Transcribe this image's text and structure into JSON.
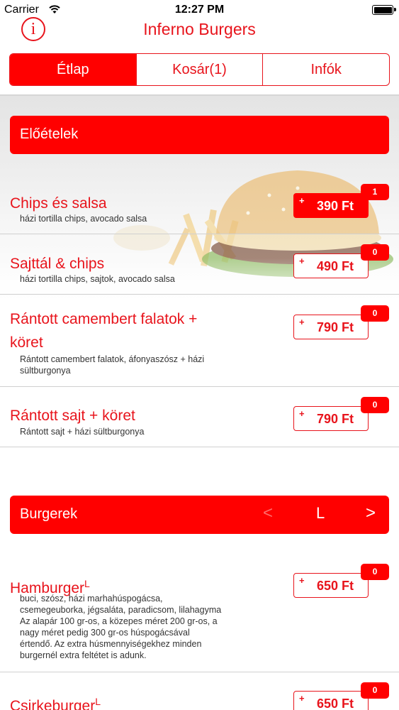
{
  "status_bar": {
    "carrier": "Carrier",
    "time": "12:27 PM"
  },
  "header": {
    "info_glyph": "i",
    "title": "Inferno Burgers"
  },
  "tabs": [
    {
      "label": "Étlap",
      "active": true
    },
    {
      "label": "Kosár(1)",
      "active": false
    },
    {
      "label": "Infók",
      "active": false
    }
  ],
  "sections": [
    {
      "title": "Előételek",
      "items": [
        {
          "name": "Chips és salsa",
          "desc": "házi tortilla chips, avocado salsa",
          "plus": "+",
          "price": "390 Ft",
          "count": "1"
        },
        {
          "name": "Sajttál & chips",
          "desc": "házi tortilla chips, sajtok, avocado salsa",
          "plus": "+",
          "price": "490 Ft",
          "count": "0"
        },
        {
          "name_line1": "Rántott camembert falatok +",
          "name_line2": "köret",
          "desc_line1": "Rántott camembert falatok, áfonyaszósz + házi",
          "desc_line2": "sültburgonya",
          "plus": "+",
          "price": "790 Ft",
          "count": "0"
        },
        {
          "name": "Rántott sajt + köret",
          "desc": "Rántott sajt + házi sültburgonya",
          "plus": "+",
          "price": "790 Ft",
          "count": "0"
        }
      ]
    },
    {
      "title": "Burgerek",
      "nav": {
        "prev": "<",
        "size": "L",
        "next": ">"
      },
      "items": [
        {
          "name": "Hamburger",
          "name_sup": "L",
          "desc_lines": [
            "buci, szósz, házi marhahúspogácsa,",
            "csemegeuborka, jégsaláta, paradicsom, lilahagyma",
            "Az alapár 100 gr-os, a közepes méret 200 gr-os, a",
            "nagy méret pedig 300 gr-os húspogácsával",
            "értendő. Az extra húsmennyiségekhez minden",
            "burgernél extra feltétet is adunk."
          ],
          "plus": "+",
          "price": "650 Ft",
          "count": "0"
        },
        {
          "name": "Csirkeburger",
          "name_sup": "L",
          "plus": "+",
          "price": "650 Ft",
          "count": "0"
        }
      ]
    }
  ],
  "colors": {
    "accent": "#ff0000",
    "text_red": "#e8141c"
  },
  "icons": [
    "wifi-icon",
    "battery-icon",
    "info-icon"
  ]
}
